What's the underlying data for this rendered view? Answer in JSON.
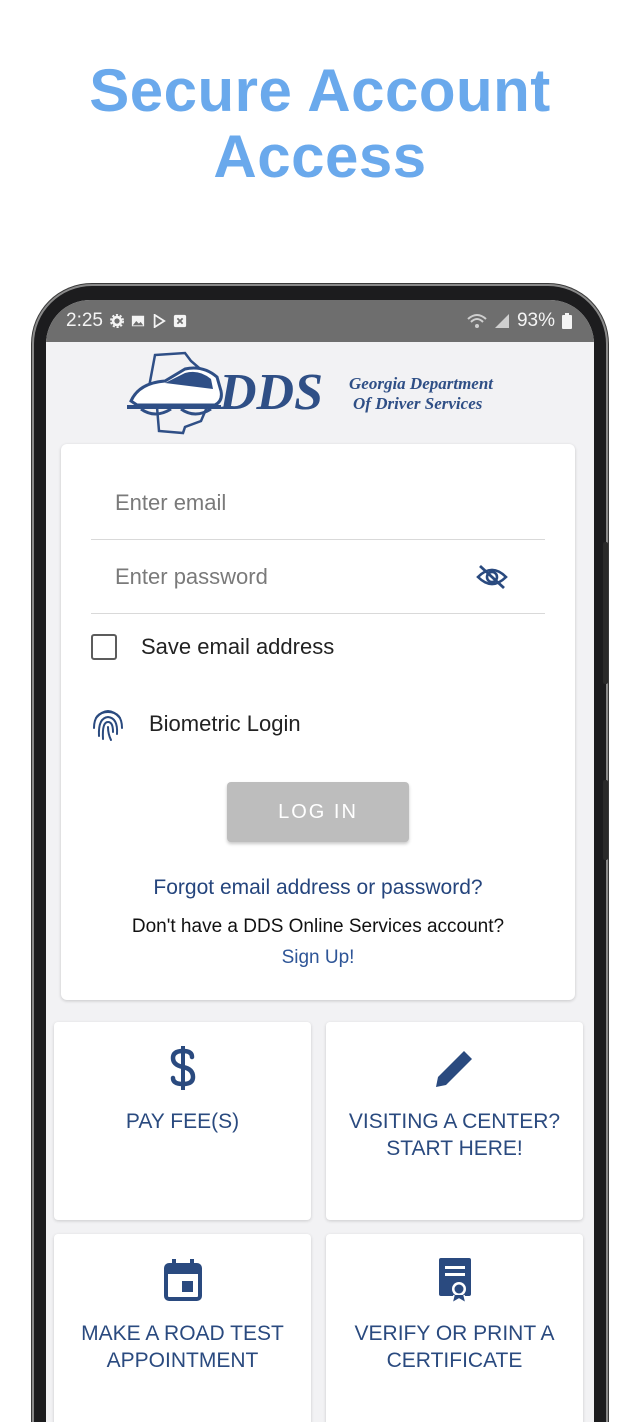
{
  "promo": {
    "line1": "Secure Account",
    "line2": "Access"
  },
  "status_bar": {
    "time": "2:25",
    "battery": "93%"
  },
  "logo": {
    "dds": "DDS",
    "line1": "Georgia Department",
    "line2": "Of Driver Services"
  },
  "login": {
    "email_placeholder": "Enter email",
    "password_placeholder": "Enter password",
    "save_email_label": "Save email address",
    "biometric_label": "Biometric Login",
    "login_button": "LOG IN",
    "forgot_link": "Forgot email address or password?",
    "no_account_text": "Don't have a DDS Online Services account?",
    "signup_link": "Sign Up!"
  },
  "tiles": [
    {
      "label": "PAY FEE(S)",
      "icon": "dollar-icon"
    },
    {
      "label": "VISITING A CENTER? START HERE!",
      "icon": "pencil-icon"
    },
    {
      "label": "MAKE A ROAD TEST APPOINTMENT",
      "icon": "calendar-icon"
    },
    {
      "label": "VERIFY OR PRINT A CERTIFICATE",
      "icon": "certificate-icon"
    }
  ],
  "colors": {
    "headline": "#6aa9ec",
    "brand_navy": "#2a4a7f",
    "link": "#25457d",
    "button_disabled": "#bdbdbd"
  }
}
